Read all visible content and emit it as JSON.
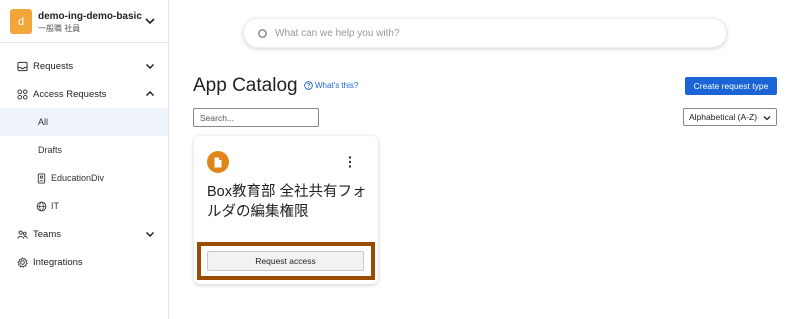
{
  "workspace": {
    "avatar_letter": "d",
    "name": "demo-ing-demo-basic",
    "subtitle": "一般職 社員"
  },
  "sidebar": {
    "items": [
      {
        "label": "Requests",
        "icon": "inbox-icon",
        "expanded": false
      },
      {
        "label": "Access Requests",
        "icon": "grid-icon",
        "expanded": true
      },
      {
        "label": "Teams",
        "icon": "people-icon",
        "expanded": false
      },
      {
        "label": "Integrations",
        "icon": "gear-icon"
      }
    ],
    "access_sub": [
      {
        "label": "All",
        "active": true
      },
      {
        "label": "Drafts"
      },
      {
        "label": "EducationDiv",
        "icon": "id-badge-icon"
      },
      {
        "label": "IT",
        "icon": "globe-icon"
      }
    ]
  },
  "search": {
    "placeholder": "What can we help you with?"
  },
  "main": {
    "title": "App Catalog",
    "whats_this": "What's this?",
    "create_button": "Create request type",
    "filter_placeholder": "Search...",
    "sort_value": "Alphabetical (A-Z)"
  },
  "card": {
    "title": "Box教育部 全社共有フォルダの編集権限",
    "button": "Request access",
    "icon_color": "#e0851a"
  },
  "colors": {
    "accent": "#1a64d6",
    "highlight": "#9a4d00"
  }
}
